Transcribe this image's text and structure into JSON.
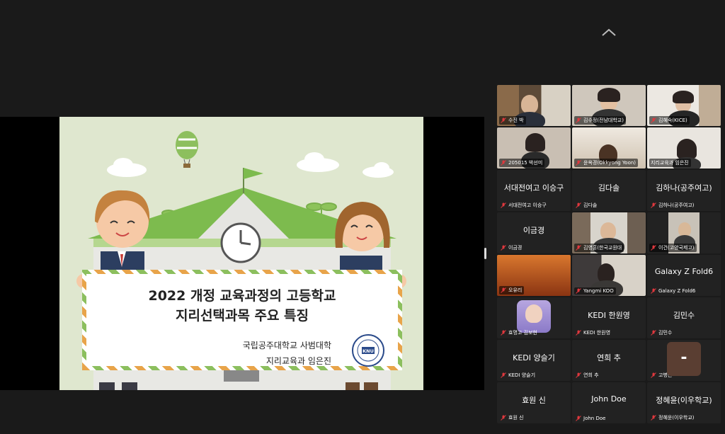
{
  "presentation": {
    "title_line1": "2022 개정 교육과정의 고등학교",
    "title_line2": "지리선택과목 주요 특징",
    "affiliation": "국립공주대학교 사범대학",
    "presenter": "지리교육과 임은진",
    "seal_letters": "KNU"
  },
  "gallery": {
    "row1": [
      {
        "name": "수진 박"
      },
      {
        "name": "김수정(전남대학교)"
      },
      {
        "name": "김혜숙(KICE)"
      }
    ],
    "row2": [
      {
        "name": "205015 박선미"
      },
      {
        "name": "윤옥경(Okkyong Yoon)"
      },
      {
        "name": "지리교육과 임은진"
      }
    ],
    "row3": [
      {
        "big": "서대전여고 이승구",
        "name": "서대전여고 이승구"
      },
      {
        "big": "김다솔",
        "name": "김다솔"
      },
      {
        "big": "김하나(공주여고)",
        "name": "김하나(공주여고)"
      }
    ],
    "row4": [
      {
        "big": "이금경",
        "name": "이금경"
      },
      {
        "name": "김영훈(한국교원대"
      },
      {
        "name": "이건(고양국제고)"
      }
    ],
    "row5": [
      {
        "name": "오유리"
      },
      {
        "name": "Yangmi KOO"
      },
      {
        "big": "Galaxy Z Fold6",
        "name": "Galaxy Z Fold6"
      }
    ],
    "row6": [
      {
        "name": "효명고 김보현"
      },
      {
        "big": "KEDI 한원영",
        "name": "KEDI 한원영"
      },
      {
        "big": "김민수",
        "name": "김민수"
      }
    ],
    "row7": [
      {
        "big": "KEDI 양슬기",
        "name": "KEDI 양슬기"
      },
      {
        "big": "연희 추",
        "name": "연희 추"
      },
      {
        "name": "고병천"
      }
    ],
    "row8": [
      {
        "big": "효원 신",
        "name": "효원 신"
      },
      {
        "big": "John Doe",
        "name": "John Doe"
      },
      {
        "big": "정혜윤(이우학교)",
        "name": "정혜윤(이우학교)"
      }
    ]
  },
  "overlay": {
    "label": "-"
  },
  "colors": {
    "active_border": "#3fc55a",
    "muted_mic": "#e0383e",
    "overlay_bg": "#5a3e32"
  }
}
